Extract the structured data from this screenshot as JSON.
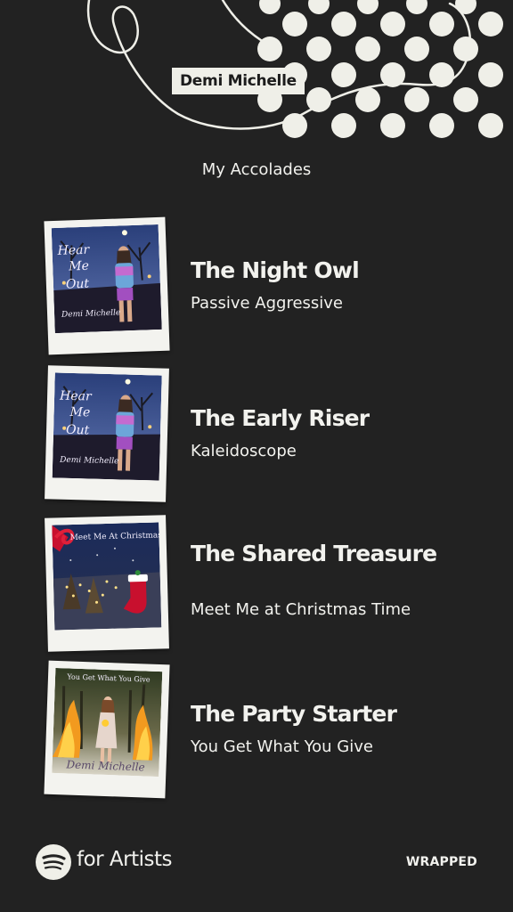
{
  "header": {
    "artist_name": "Demi Michelle",
    "heading": "My Accolades"
  },
  "accolades": [
    {
      "title": "The Night Owl",
      "song": "Passive Aggressive",
      "cover_text": [
        "Hear",
        "Me",
        "Out",
        "Demi Michelle"
      ]
    },
    {
      "title": "The Early Riser",
      "song": "Kaleidoscope",
      "cover_text": [
        "Hear",
        "Me",
        "Out",
        "Demi Michelle"
      ]
    },
    {
      "title": "The Shared Treasure",
      "song": "Meet Me at Christmas Time",
      "cover_text": [
        "Meet Me At Christmas Time"
      ]
    },
    {
      "title": "The Party Starter",
      "song": "You Get What You Give",
      "cover_text": [
        "You Get What You Give",
        "Demi Michelle"
      ]
    }
  ],
  "footer": {
    "brand": "for Artists",
    "wrapped": "WRAPPED"
  },
  "colors": {
    "background": "#222222",
    "cream": "#efefe8"
  }
}
